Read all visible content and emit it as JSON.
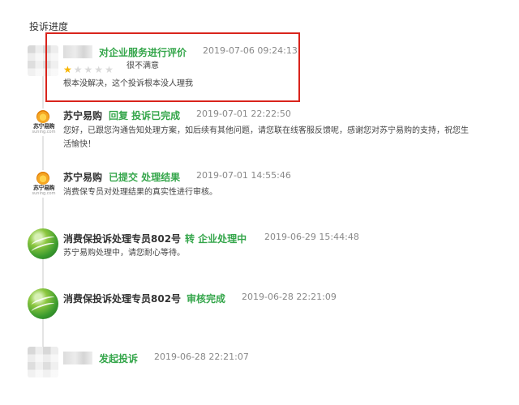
{
  "section_title": "投诉进度",
  "entries": [
    {
      "avatar": "blurred-avatar",
      "name": "",
      "status": "对企业服务进行评价",
      "time": "2019-07-06 09:24:13",
      "rating": {
        "score": 1,
        "max": 5,
        "label": "很不满意"
      },
      "text": "根本没解决，这个投诉根本没人理我"
    },
    {
      "avatar": "suning-logo",
      "avatar_cn": "苏宁易购",
      "avatar_en": "suning.com",
      "name": "苏宁易购",
      "status": "回复  投诉已完成",
      "time": "2019-07-01 22:22:50",
      "text": "您好，已跟您沟通告知处理方案，如后续有其他问题，请您联在线客服反馈呢，感谢您对苏宁易购的支持，祝您生活愉快！"
    },
    {
      "avatar": "suning-logo",
      "avatar_cn": "苏宁易购",
      "avatar_en": "suning.com",
      "name": "苏宁易购",
      "status": "已提交  处理结果",
      "time": "2019-07-01 14:55:46",
      "text": "消费保专员对处理结果的真实性进行审核。"
    },
    {
      "avatar": "globe-logo",
      "name": "消费保投诉处理专员802号",
      "status": "转  企业处理中",
      "time": "2019-06-29 15:44:48",
      "text": "苏宁易购处理中，请您耐心等待。"
    },
    {
      "avatar": "globe-logo",
      "name": "消费保投诉处理专员802号",
      "status": "审核完成",
      "time": "2019-06-28 22:21:09",
      "text": ""
    },
    {
      "avatar": "blurred-avatar",
      "name": "",
      "status": "发起投诉",
      "time": "2019-06-28 22:21:07",
      "text": ""
    }
  ],
  "colors": {
    "status": "#35a64b",
    "highlight_border": "#d9241c",
    "star_on": "#f7b500",
    "star_off": "#d9d9d9"
  }
}
